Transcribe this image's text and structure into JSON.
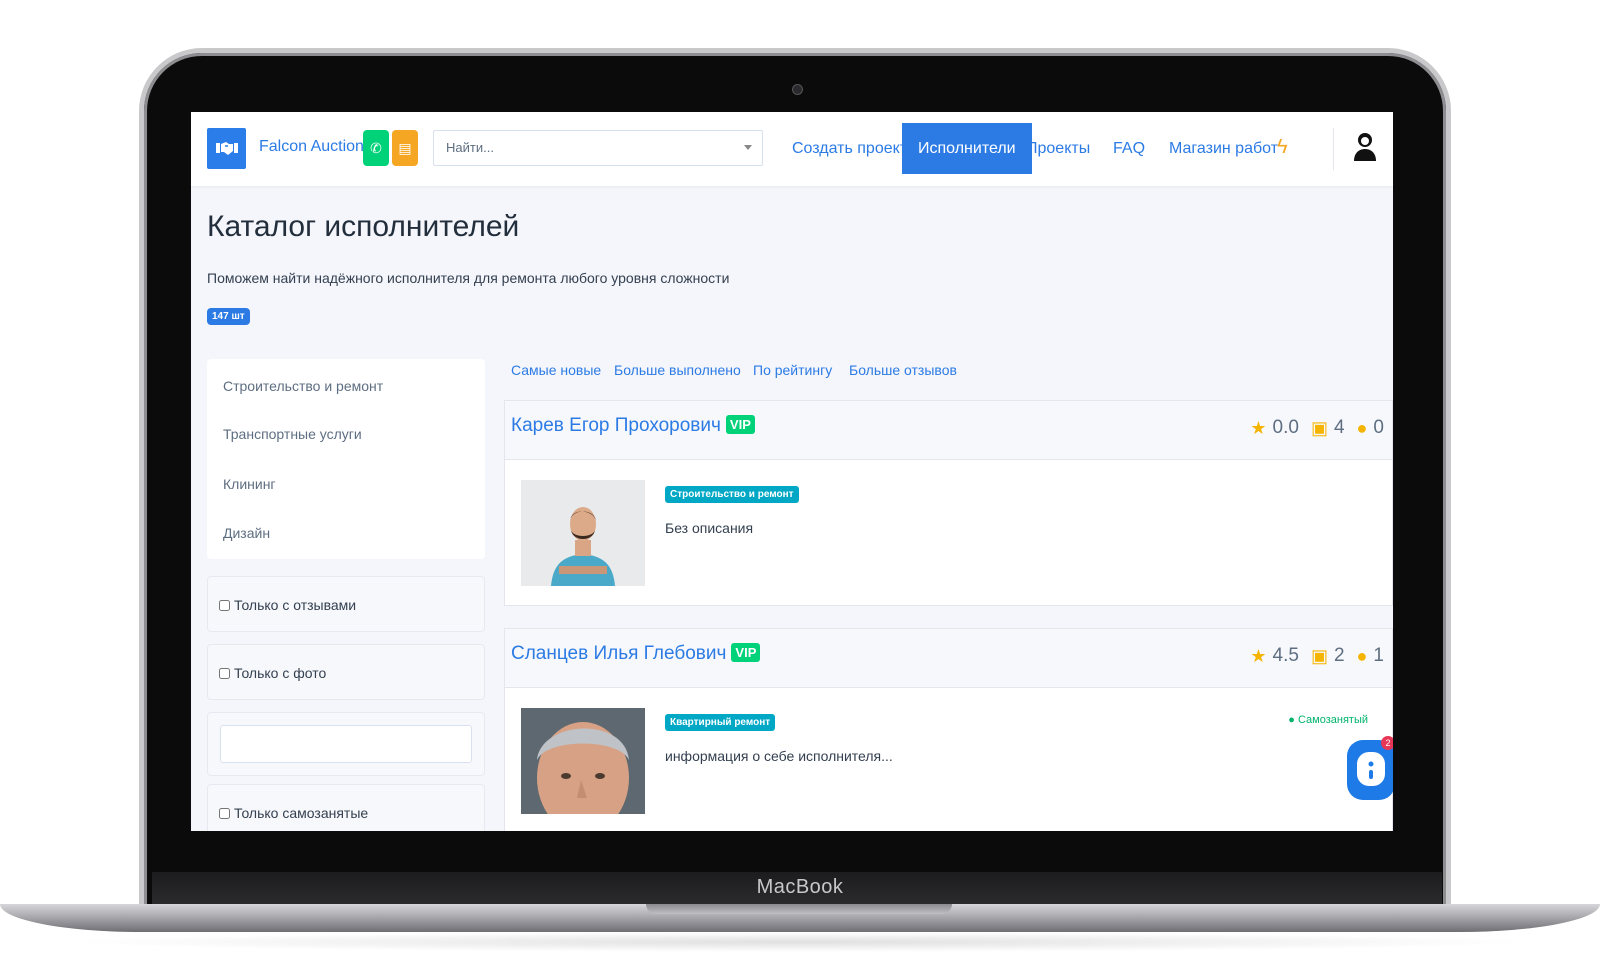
{
  "device": {
    "brand": "MacBook"
  },
  "navbar": {
    "brand": "Falcon Auction",
    "search_placeholder": "Найти...",
    "items": [
      "Создать проект",
      "Исполнители",
      "Проекты",
      "FAQ",
      "Магазин работ"
    ],
    "active": "Исполнители",
    "accent": "#2c7be5"
  },
  "page": {
    "title": "Каталог исполнителей",
    "subtitle": "Поможем найти надёжного исполнителя для ремонта любого уровня сложности",
    "count": "147 шт"
  },
  "sidebar": {
    "categories": [
      "Строительство и ремонт",
      "Транспортные услуги",
      "Клининг",
      "Дизайн"
    ],
    "filters": {
      "with_reviews": "Только с отзывами",
      "with_photo": "Только с фото",
      "self_employed": "Только самозанятые"
    }
  },
  "sort_tabs": [
    "Самые новые",
    "Больше выполнено",
    "По рейтингу",
    "Больше отзывов"
  ],
  "executors": [
    {
      "name": "Карев Егор Прохорович",
      "vip": "VIP",
      "rating": "0.0",
      "done": "4",
      "reviews": "0",
      "category": "Строительство и ремонт",
      "description": "Без описания",
      "status": ""
    },
    {
      "name": "Сланцев Илья Глебович",
      "vip": "VIP",
      "rating": "4.5",
      "done": "2",
      "reviews": "1",
      "category": "Квартирный ремонт",
      "description": "информация о себе исполнителя...",
      "status": "Самозанятый"
    }
  ],
  "chat_widget": {
    "unread": "2"
  }
}
